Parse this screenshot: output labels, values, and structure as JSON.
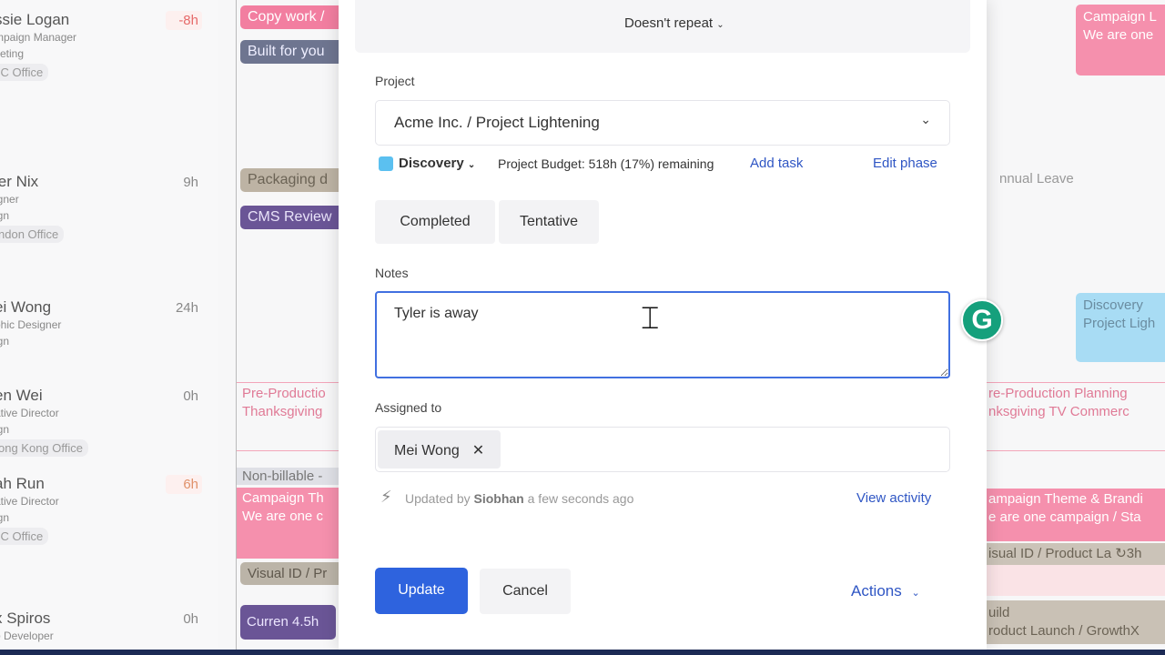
{
  "people": [
    {
      "name": "ssie Logan",
      "role": "mpaign Manager",
      "dept": "keting",
      "office": "'C Office",
      "hours": "-8h",
      "hours_color": "#e66a6a"
    },
    {
      "name": "ler Nix",
      "role": "igner",
      "dept": "ign",
      "office": "ndon Office",
      "hours": "9h",
      "hours_color": "#888888"
    },
    {
      "name": "ei Wong",
      "role": "phic Designer",
      "dept": "ign",
      "office": "",
      "hours": "24h",
      "hours_color": "#888888"
    },
    {
      "name": "en Wei",
      "role": "ative Director",
      "dept": "ign",
      "office": "ong Kong Office",
      "hours": "0h",
      "hours_color": "#888888"
    },
    {
      "name": "ah Run",
      "role": "ative Director",
      "dept": "ign",
      "office": "'C Office",
      "hours": "6h",
      "hours_color": "#e0916a"
    },
    {
      "name": "x Spiros",
      "role": "o Developer",
      "dept": "",
      "office": "",
      "hours": "0h",
      "hours_color": "#888888"
    }
  ],
  "calendar_left": {
    "copy_work": "Copy work /",
    "built_for_you": "Built for you",
    "packaging": "Packaging d",
    "cms_review": "CMS Review",
    "preprod_1": "Pre-Productio",
    "preprod_2": "Thanksgiving",
    "non_billable": "Non-billable -",
    "campaign_1": "Campaign Th",
    "campaign_2": "We are one c",
    "visual_id": "Visual ID / Pr",
    "curren": "Curren 4.5h"
  },
  "calendar_right": {
    "campaign_l1": "Campaign L",
    "campaign_l2": "We are one",
    "annual_leave": "nnual Leave",
    "discovery_1": "Discovery",
    "discovery_2": "Project Ligh",
    "preprod_1": "re-Production Planning",
    "preprod_2": "nksgiving TV Commerc",
    "theme_1": "ampaign Theme & Brandi",
    "theme_2": "e are one campaign / Sta",
    "visual_id": "isual ID / Product La ↻3h",
    "build_1": "uild",
    "build_2": "roduct Launch / GrowthX"
  },
  "modal": {
    "repeat": "Doesn't repeat",
    "project_label": "Project",
    "project_value": "Acme Inc. / Project Lightening",
    "phase": "Discovery",
    "phase_color": "#5bc0f0",
    "budget": "Project Budget: 518h (17%) remaining",
    "add_task": "Add task",
    "edit_phase": "Edit phase",
    "completed": "Completed",
    "tentative": "Tentative",
    "notes_label": "Notes",
    "notes_value": "Tyler is away",
    "assigned_label": "Assigned to",
    "assignee": "Mei Wong",
    "updated_prefix": "Updated by",
    "updated_by": "Siobhan",
    "updated_suffix": "a few seconds ago",
    "view_activity": "View activity",
    "update": "Update",
    "cancel": "Cancel",
    "actions": "Actions"
  },
  "grammarly_letter": "G"
}
